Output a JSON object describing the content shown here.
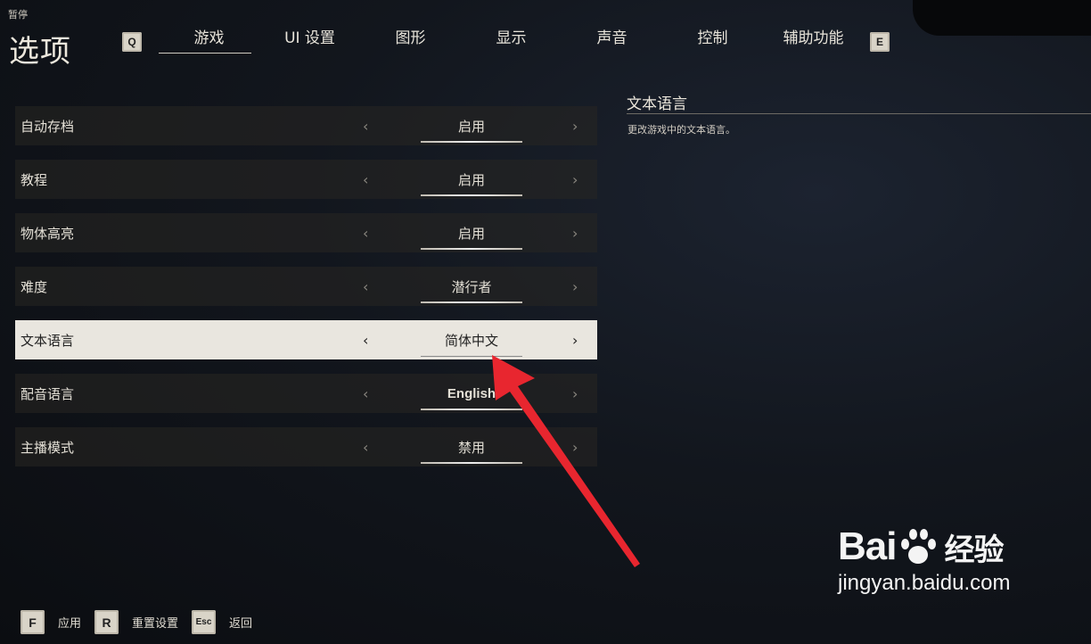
{
  "header": {
    "pause_label": "暂停",
    "title": "选项",
    "prev_tab_key": "Q",
    "next_tab_key": "E",
    "tabs": [
      {
        "label": "游戏",
        "active": true
      },
      {
        "label": "UI 设置"
      },
      {
        "label": "图形"
      },
      {
        "label": "显示"
      },
      {
        "label": "声音"
      },
      {
        "label": "控制"
      },
      {
        "label": "辅助功能"
      }
    ]
  },
  "settings": [
    {
      "label": "自动存档",
      "value": "启用"
    },
    {
      "label": "教程",
      "value": "启用"
    },
    {
      "label": "物体高亮",
      "value": "启用"
    },
    {
      "label": "难度",
      "value": "潜行者"
    },
    {
      "label": "文本语言",
      "value": "简体中文",
      "selected": true
    },
    {
      "label": "配音语言",
      "value": "English"
    },
    {
      "label": "主播模式",
      "value": "禁用"
    }
  ],
  "description": {
    "title": "文本语言",
    "text": "更改游戏中的文本语言。"
  },
  "footer": {
    "apply_key": "F",
    "apply_label": "应用",
    "reset_key": "R",
    "reset_label": "重置设置",
    "back_key": "Esc",
    "back_label": "返回"
  },
  "watermark": {
    "brand_left": "Bai",
    "brand_right": "经验",
    "site": "jingyan.baidu.com"
  },
  "colors": {
    "annotation_arrow": "#e8262f",
    "selected_row": "#e9e6df"
  },
  "icons": {
    "left_arrow": "‹",
    "right_arrow": "›"
  }
}
